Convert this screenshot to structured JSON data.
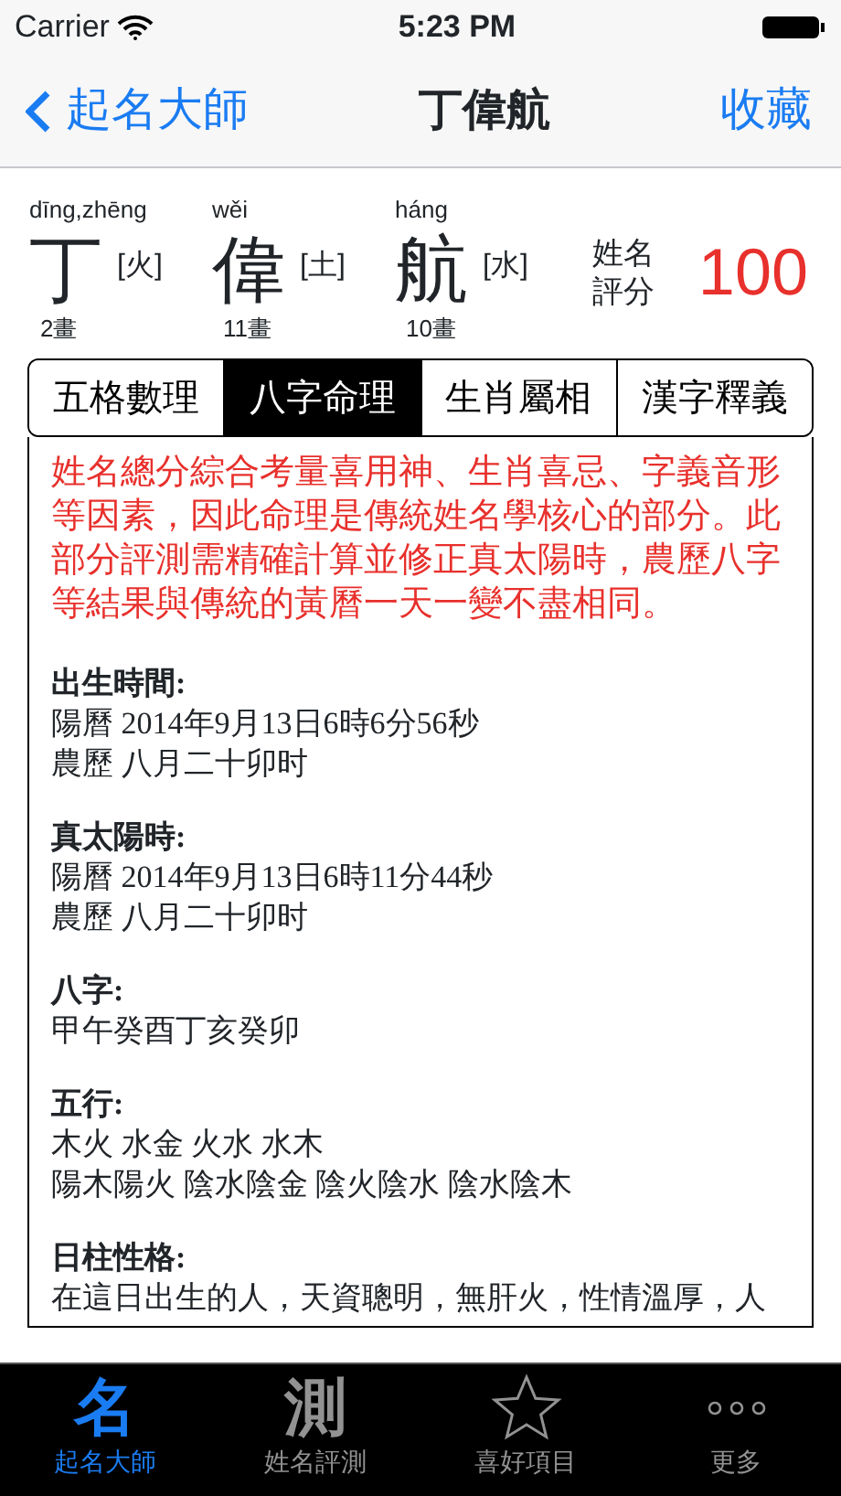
{
  "status_bar": {
    "carrier": "Carrier",
    "time": "5:23 PM"
  },
  "nav_bar": {
    "back": "起名大師",
    "title": "丁偉航",
    "action": "收藏"
  },
  "name_chars": [
    {
      "pinyin": "dīng,zhēng",
      "char": "丁",
      "element": "[火]",
      "strokes": "2畫"
    },
    {
      "pinyin": "wěi",
      "char": "偉",
      "element": "[土]",
      "strokes": "11畫"
    },
    {
      "pinyin": "háng",
      "char": "航",
      "element": "[水]",
      "strokes": "10畫"
    }
  ],
  "score": {
    "label_1": "姓名",
    "label_2": "評分",
    "value": "100"
  },
  "segments": [
    {
      "label": "五格數理",
      "selected": false
    },
    {
      "label": "八字命理",
      "selected": true
    },
    {
      "label": "生肖屬相",
      "selected": false
    },
    {
      "label": "漢字釋義",
      "selected": false
    }
  ],
  "notice": "姓名總分綜合考量喜用神、生肖喜忌、字義音形等因素，因此命理是傳統姓名學核心的部分。此部分評測需精確計算並修正真太陽時，農歷八字等結果與傳統的黃曆一天一變不盡相同。",
  "sections": [
    {
      "heading": "出生時間:",
      "lines": [
        "陽曆 2014年9月13日6時6分56秒",
        "農歷 八月二十卯时"
      ]
    },
    {
      "heading": "真太陽時:",
      "lines": [
        "陽曆 2014年9月13日6時11分44秒",
        "農歷 八月二十卯时"
      ]
    },
    {
      "heading": "八字:",
      "lines": [
        "甲午癸酉丁亥癸卯"
      ]
    },
    {
      "heading": "五行:",
      "lines": [
        "木火 水金 火水 水木",
        "陽木陽火 陰水陰金 陰火陰水 陰水陰木"
      ]
    },
    {
      "heading": "日柱性格:",
      "lines": [
        "在這日出生的人，天資聰明，無肝火，性情溫厚，人"
      ]
    }
  ],
  "tab_bar": [
    {
      "kind": "glyph",
      "glyph": "名",
      "label": "起名大師",
      "selected": true
    },
    {
      "kind": "glyph",
      "glyph": "測",
      "label": "姓名評測",
      "selected": false
    },
    {
      "kind": "star",
      "label": "喜好項目",
      "selected": false
    },
    {
      "kind": "dots",
      "label": "更多",
      "selected": false
    }
  ]
}
